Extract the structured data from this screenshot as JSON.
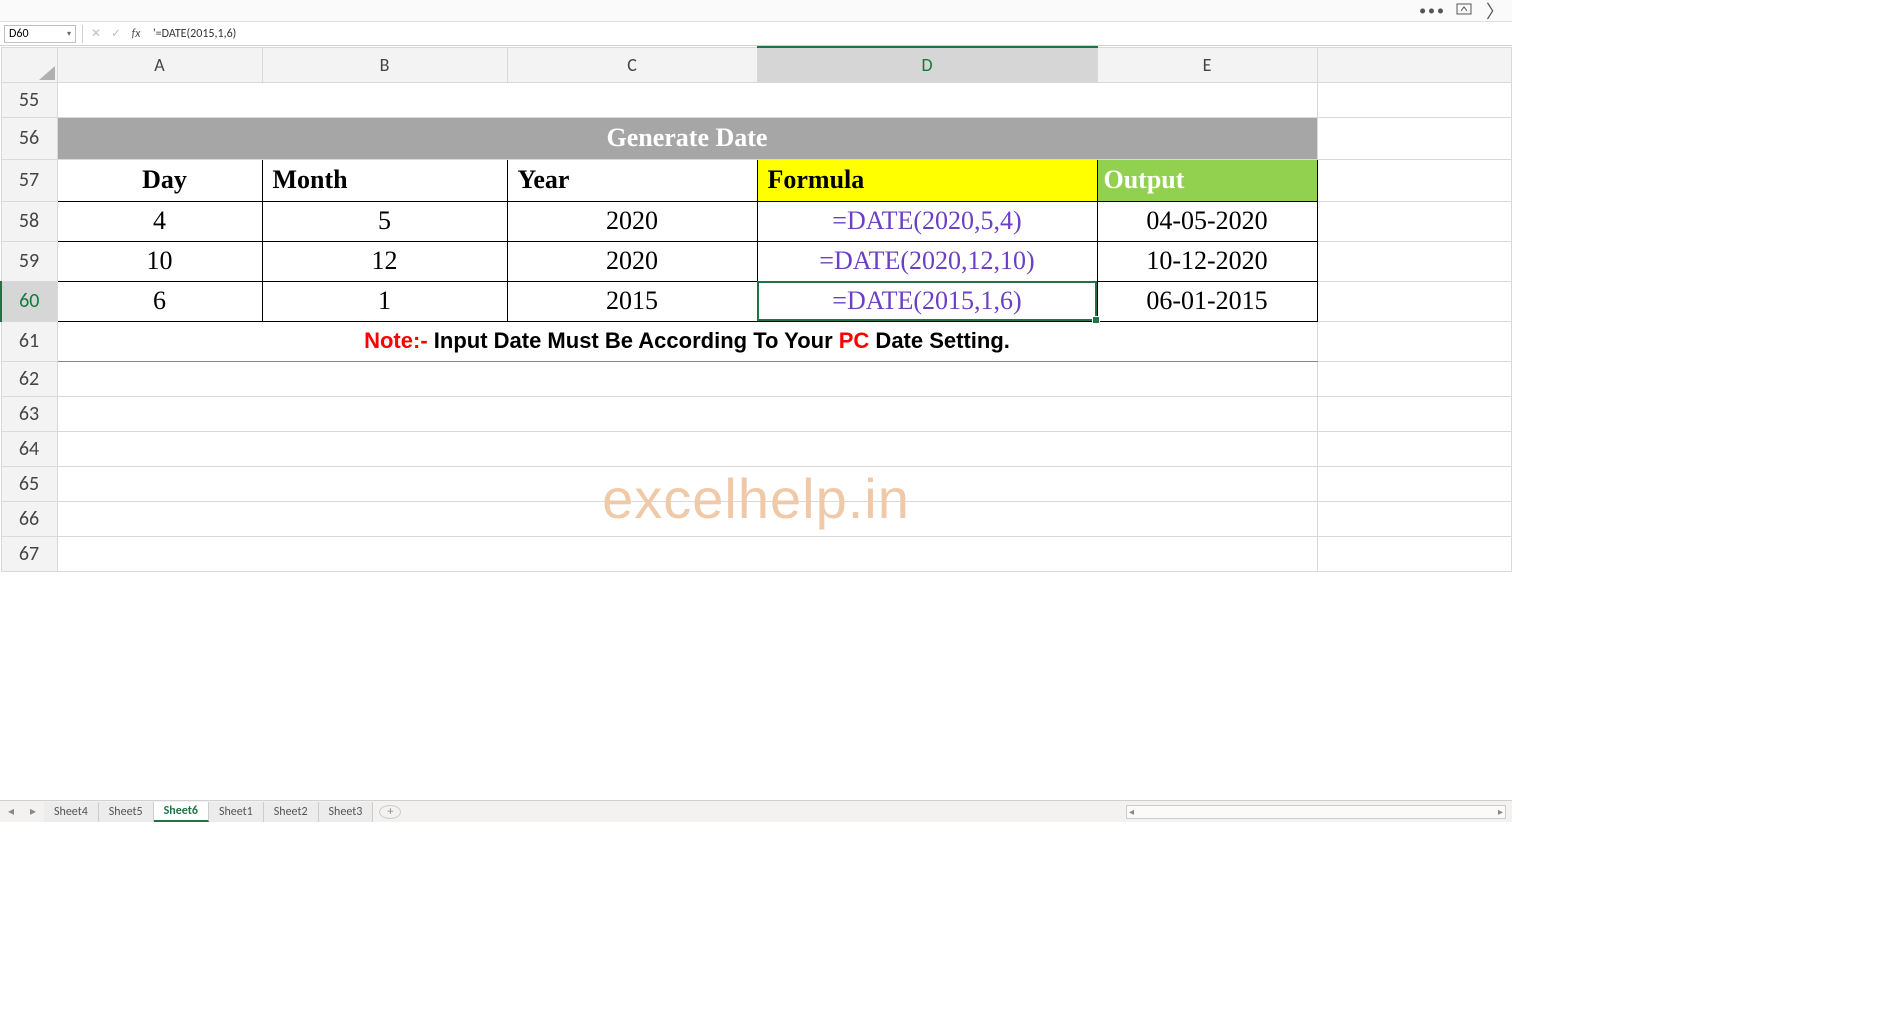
{
  "titlebar": {
    "dots": "•••"
  },
  "fbar": {
    "cellref": "D60",
    "formula": "'=DATE(2015,1,6)"
  },
  "columns": [
    "A",
    "B",
    "C",
    "D",
    "E"
  ],
  "rows": [
    "55",
    "56",
    "57",
    "58",
    "59",
    "60",
    "61",
    "62",
    "63",
    "64",
    "65",
    "66",
    "67"
  ],
  "active": {
    "col": "D",
    "row": "60"
  },
  "content": {
    "title": "Generate Date",
    "headers": {
      "day": "Day",
      "month": "Month",
      "year": "Year",
      "formula": "Formula",
      "output": "Output"
    },
    "data": [
      {
        "day": "4",
        "month": "5",
        "year": "2020",
        "formula": "=DATE(2020,5,4)",
        "output": "04-05-2020"
      },
      {
        "day": "10",
        "month": "12",
        "year": "2020",
        "formula": "=DATE(2020,12,10)",
        "output": "10-12-2020"
      },
      {
        "day": "6",
        "month": "1",
        "year": "2015",
        "formula": "=DATE(2015,1,6)",
        "output": "06-01-2015"
      }
    ],
    "note_pre": "Note:-",
    "note_mid": " Input Date Must Be According To Your ",
    "note_pc": "PC",
    "note_post": " Date Setting."
  },
  "watermark": "excelhelp.in",
  "sheets": {
    "tabs": [
      "Sheet4",
      "Sheet5",
      "Sheet6",
      "Sheet1",
      "Sheet2",
      "Sheet3"
    ],
    "active": "Sheet6",
    "add": "+"
  }
}
